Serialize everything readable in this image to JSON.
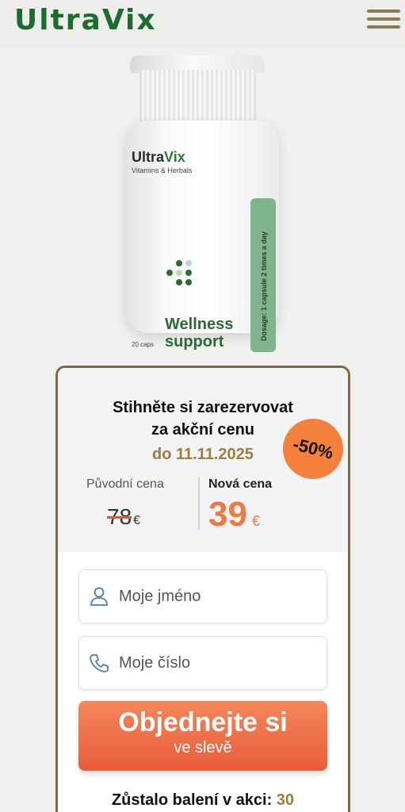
{
  "header": {
    "logo_text": "UltraVix",
    "menu_icon": "hamburger-menu-icon",
    "brand_color": "#1e6b2e"
  },
  "product": {
    "brand_ultra": "Ultra",
    "brand_vix": "Vix",
    "subtitle": "Vitamins & Herbals",
    "name_line1": "Wellness",
    "name_line2": "support",
    "caps": "20 caps",
    "dosage": "Dosage: 1 capsule 2 times a day"
  },
  "offer": {
    "headline_line1": "Stihněte si zarezervovat",
    "headline_line2": "za akční cenu",
    "deadline": "do 11.11.2025",
    "discount_badge": "-50%",
    "old_label": "Původní cena",
    "old_price": "78",
    "old_currency": "€",
    "new_label": "Nová cena",
    "new_price": "39",
    "new_currency": "€",
    "accent_color": "#ec7a42",
    "gold_color": "#9a7f3e"
  },
  "form": {
    "name_placeholder": "Moje jméno",
    "phone_placeholder": "Moje číslo",
    "cta_line1": "Objednejte si",
    "cta_line2": "ve slevě"
  },
  "stock": {
    "label": "Zůstalo balení v akci:",
    "count": "30"
  }
}
